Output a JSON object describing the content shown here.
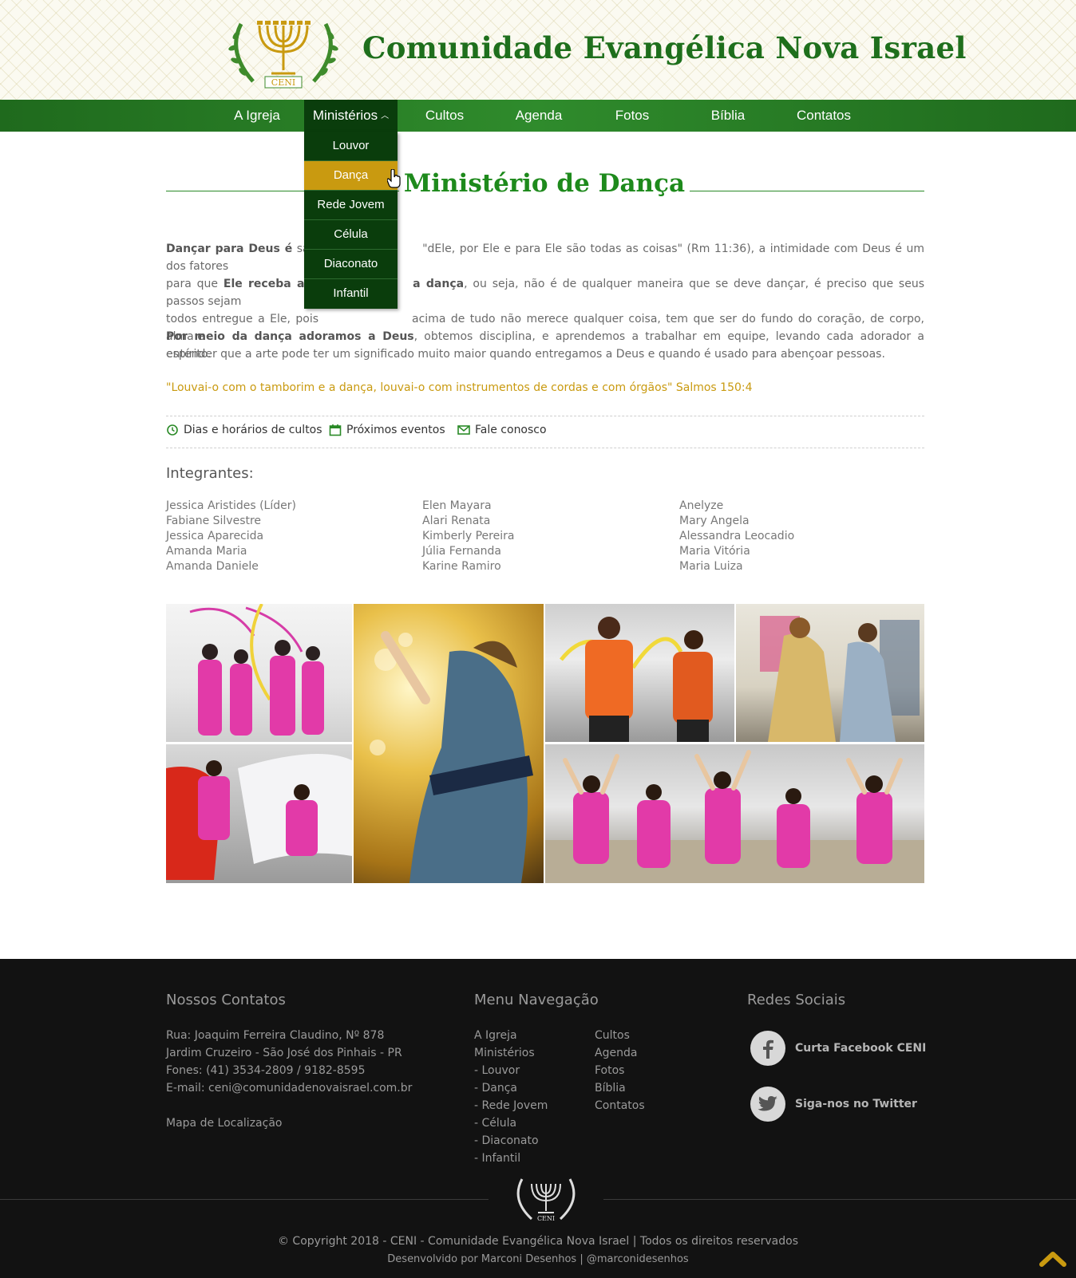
{
  "header": {
    "title": "Comunidade Evangélica Nova Israel",
    "logo_text": "CENI"
  },
  "nav": {
    "items": [
      "A Igreja",
      "Ministérios",
      "Cultos",
      "Agenda",
      "Fotos",
      "Bíblia",
      "Contatos"
    ],
    "active": "Ministérios",
    "dropdown": [
      "Louvor",
      "Dança",
      "Rede Jovem",
      "Célula",
      "Diaconato",
      "Infantil"
    ],
    "dropdown_hover": "Dança"
  },
  "page": {
    "title": "Ministério de Dança",
    "p1_bold1": "Dançar para Deus é",
    "p1_t1": " sabe",
    "p1_t2": "\"dEle, por Ele e para Ele são todas as coisas\" (Rm 11:36), a intimidade com Deus é um dos fatores",
    "p1_t3": "para que ",
    "p1_bold2": "Ele receba a ad",
    "p1_bold3": "a dança",
    "p1_t4": ", ou seja, não é de qualquer maneira que se deve dançar, é preciso que seus passos sejam",
    "p1_t5": "todos entregue a Ele, pois",
    "p1_t6": "acima de tudo não merece qualquer coisa, tem que ser do fundo do coração, de corpo, alma e",
    "p1_t7": "espírito.",
    "p2_bold": "Por meio da dança adoramos a Deus",
    "p2_text": ", obtemos disciplina, e aprendemos a trabalhar em equipe, levando cada adorador a entender que a arte pode ter um significado muito maior quando entregamos a Deus e quando é usado para abençoar pessoas.",
    "quote": "\"Louvai-o com o tamborim e a dança, louvai-o com instrumentos de cordas e com órgãos\" Salmos 150:4",
    "links": [
      "Dias e horários de cultos",
      "Próximos eventos",
      "Fale conosco"
    ],
    "members_title": "Integrantes:",
    "members": [
      [
        "Jessica Aristides (Líder)",
        "Fabiane Silvestre",
        "Jessica Aparecida",
        "Amanda Maria",
        "Amanda Daniele"
      ],
      [
        "Elen Mayara",
        "Alari Renata",
        "Kimberly Pereira",
        "Júlia Fernanda",
        "Karine Ramiro"
      ],
      [
        "Anelyze",
        "Mary Angela",
        "Alessandra Leocadio",
        "Maria Vitória",
        "Maria Luiza"
      ]
    ]
  },
  "footer": {
    "contacts_title": "Nossos Contatos",
    "contacts": [
      "Rua: Joaquim Ferreira Claudino, Nº 878",
      "Jardim Cruzeiro - São José dos Pinhais - PR",
      "Fones: (41) 3534-2809 / 9182-8595",
      "E-mail: ceni@comunidadenovaisrael.com.br"
    ],
    "map_link": "Mapa de Localização",
    "nav_title": "Menu Navegação",
    "nav_col1": [
      "A Igreja",
      "Ministérios",
      "- Louvor",
      "- Dança",
      "- Rede Jovem",
      "- Célula",
      "- Diaconato",
      "- Infantil"
    ],
    "nav_col2": [
      "Cultos",
      "Agenda",
      "Fotos",
      "Bíblia",
      "Contatos"
    ],
    "social_title": "Redes Sociais",
    "facebook": "Curta Facebook CENI",
    "twitter": "Siga-nos no Twitter",
    "copyright": "© Copyright 2018 - CENI - Comunidade Evangélica Nova Israel | Todos os direitos reservados",
    "credits": "Desenvolvido por Marconi Desenhos | @marconidesenhos"
  },
  "colors": {
    "green": "#2a8a27",
    "dark_green": "#0a3d0c",
    "gold": "#c99a10",
    "footer_bg": "#121212"
  },
  "icons": [
    "menorah-logo-icon",
    "clock-icon",
    "calendar-icon",
    "mail-icon",
    "facebook-icon",
    "twitter-icon",
    "chevron-up-icon",
    "hand-cursor-icon"
  ]
}
